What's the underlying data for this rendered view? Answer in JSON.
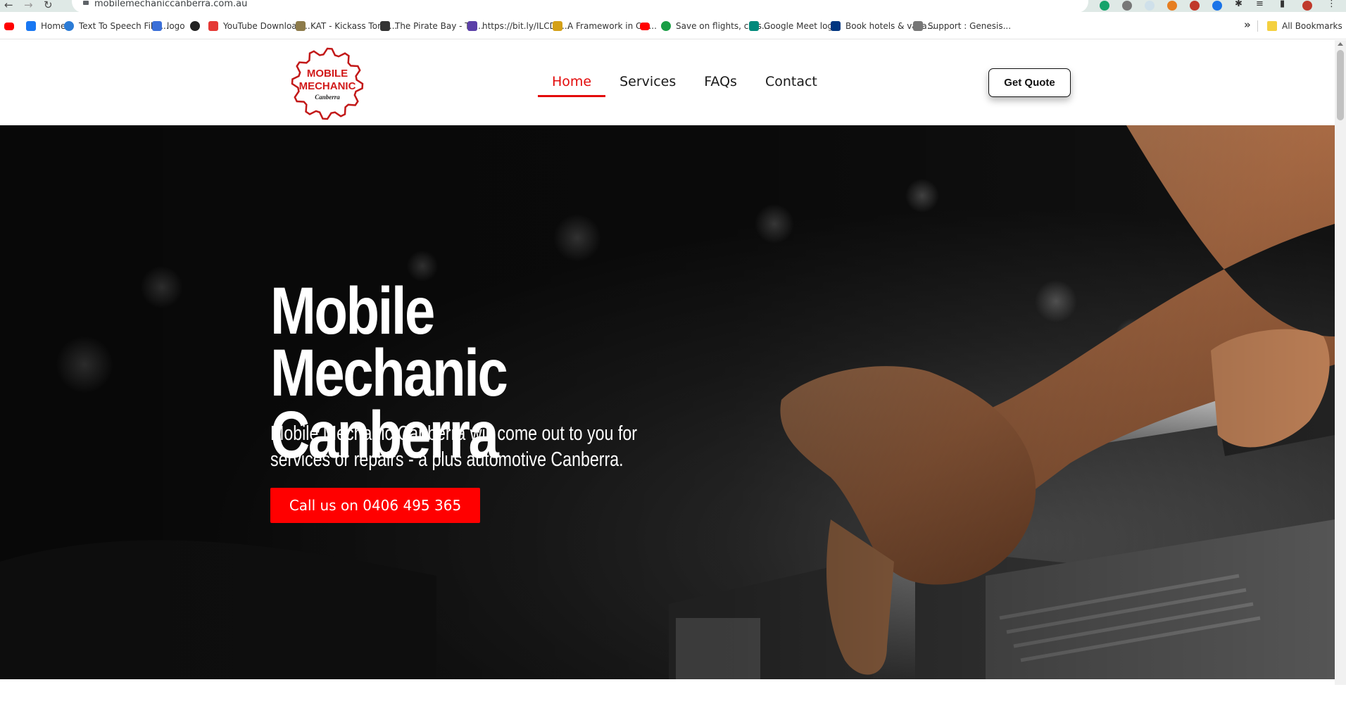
{
  "browser": {
    "url": "mobilemechaniccanberra.com.au",
    "bookmarks": [
      {
        "label": "",
        "icon": "youtube-icon",
        "color": "#ff0000"
      },
      {
        "label": "Home",
        "icon": "meta-icon",
        "color": "#1877f2"
      },
      {
        "label": "Text To Speech Filip...",
        "icon": "tts-icon",
        "color": "#2b7bd6"
      },
      {
        "label": "logo",
        "icon": "shield-logo-icon",
        "color": "#3a6fd8"
      },
      {
        "label": "",
        "icon": "globe-icon",
        "color": "#222222"
      },
      {
        "label": "YouTube Download...",
        "icon": "download-icon",
        "color": "#e53935"
      },
      {
        "label": "KAT - Kickass Torre...",
        "icon": "kat-icon",
        "color": "#8d7b4a"
      },
      {
        "label": "The Pirate Bay - Th...",
        "icon": "pirate-ship-icon",
        "color": "#333333"
      },
      {
        "label": "https://bit.ly/ILCDB...",
        "icon": "bitly-icon",
        "color": "#5b3fa8"
      },
      {
        "label": "A Framework in C#...",
        "icon": "framework-icon",
        "color": "#d4a017"
      },
      {
        "label": "",
        "icon": "youtube-icon",
        "color": "#ff0000"
      },
      {
        "label": "Save on flights, cars...",
        "icon": "expedia-icon",
        "color": "#1a9e45"
      },
      {
        "label": "Google Meet logo",
        "icon": "google-meet-icon",
        "color": "#00897b"
      },
      {
        "label": "Book hotels & vaca...",
        "icon": "booking-icon",
        "color": "#003580"
      },
      {
        "label": "Support : Genesis...",
        "icon": "grid-icon",
        "color": "#777777"
      }
    ],
    "all_bookmarks": "All Bookmarks"
  },
  "site": {
    "logo_text": {
      "line1": "MOBILE",
      "line2": "MECHANIC",
      "line3": "Canberra"
    },
    "nav": [
      "Home",
      "Services",
      "FAQs",
      "Contact"
    ],
    "active_nav": "Home",
    "quote_button": "Get Quote"
  },
  "hero": {
    "title_line1": "Mobile Mechanic",
    "title_line2": "Canberra",
    "subtitle": "Mobile Mechanic Canberra will come out to you for services or repairs - a plus automotive Canberra.",
    "cta": "Call us on 0406 495 365"
  },
  "colors": {
    "accent": "#ff0000",
    "nav_active": "#e30b0b",
    "text_dark": "#1a1a1a",
    "hero_bg": "#161616"
  }
}
